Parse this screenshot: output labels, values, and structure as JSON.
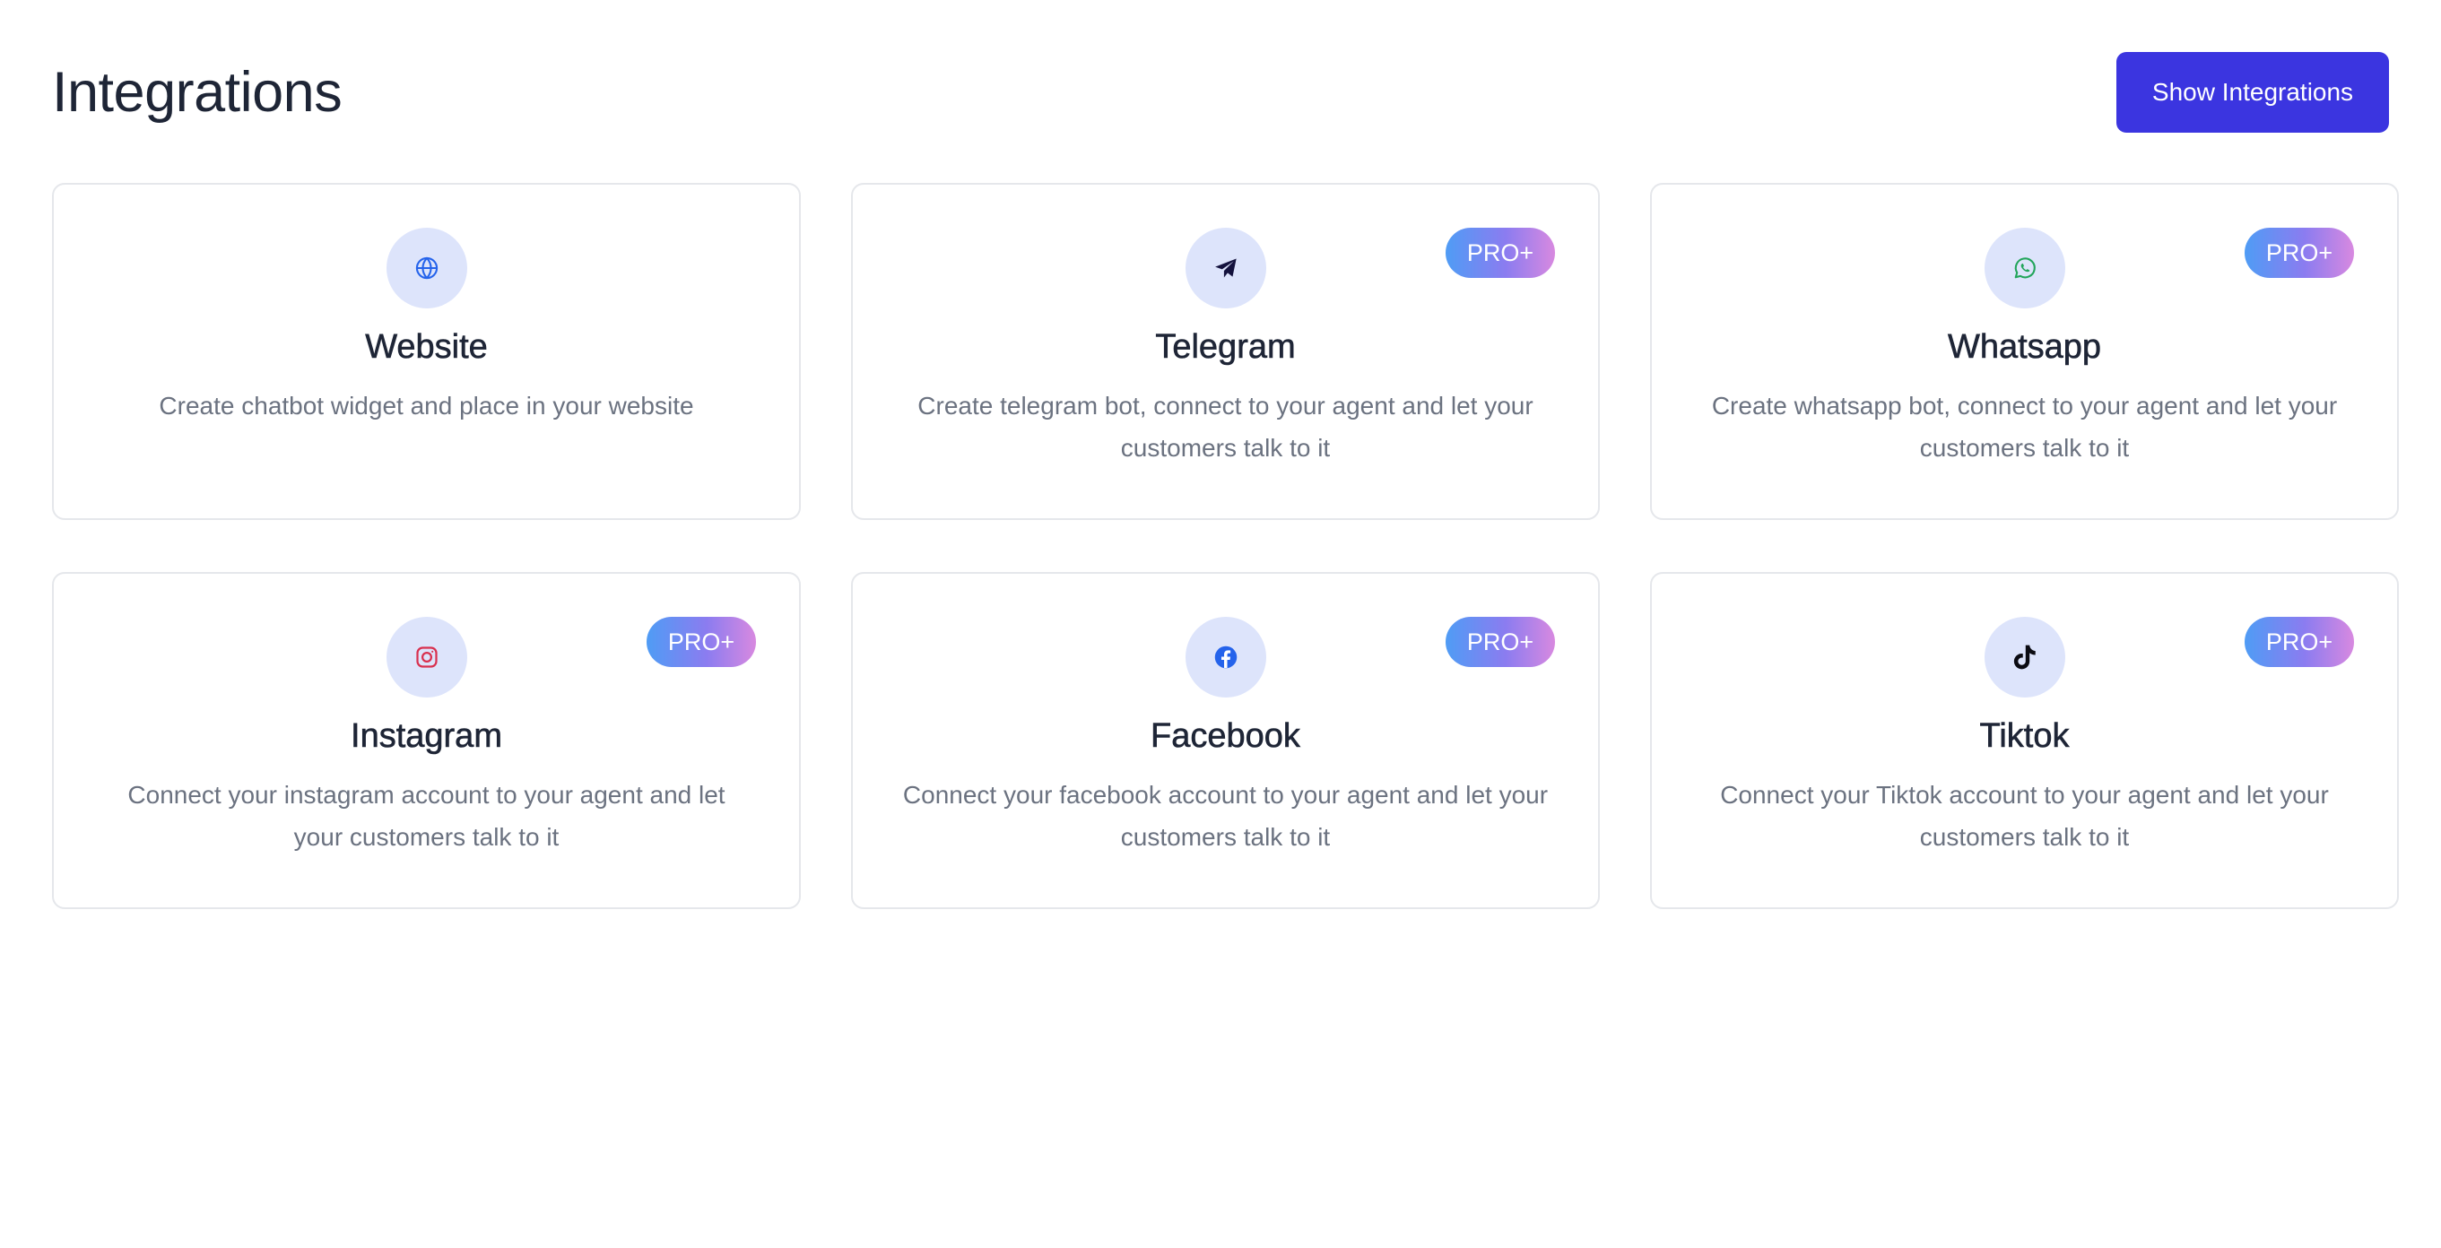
{
  "header": {
    "title": "Integrations",
    "show_button_label": "Show Integrations"
  },
  "colors": {
    "accent": "#3b35e0",
    "icon_circle": "#dde4fb",
    "badge_gradient": [
      "#4f9cf5",
      "#8b7cf0",
      "#d889e0"
    ]
  },
  "cards": [
    {
      "title": "Website",
      "description": "Create chatbot widget and place in your website",
      "icon": "globe-icon",
      "badge": ""
    },
    {
      "title": "Telegram",
      "description": "Create telegram bot, connect to your agent and let your customers talk to it",
      "icon": "telegram-icon",
      "badge": "PRO+"
    },
    {
      "title": "Whatsapp",
      "description": "Create whatsapp bot, connect to your agent and let your customers talk to it",
      "icon": "whatsapp-icon",
      "badge": "PRO+"
    },
    {
      "title": "Instagram",
      "description": "Connect your instagram account to your agent and let your customers talk to it",
      "icon": "instagram-icon",
      "badge": "PRO+"
    },
    {
      "title": "Facebook",
      "description": "Connect your facebook account to your agent and let your customers talk to it",
      "icon": "facebook-icon",
      "badge": "PRO+"
    },
    {
      "title": "Tiktok",
      "description": "Connect your Tiktok account to your agent and let your customers talk to it",
      "icon": "tiktok-icon",
      "badge": "PRO+"
    }
  ]
}
